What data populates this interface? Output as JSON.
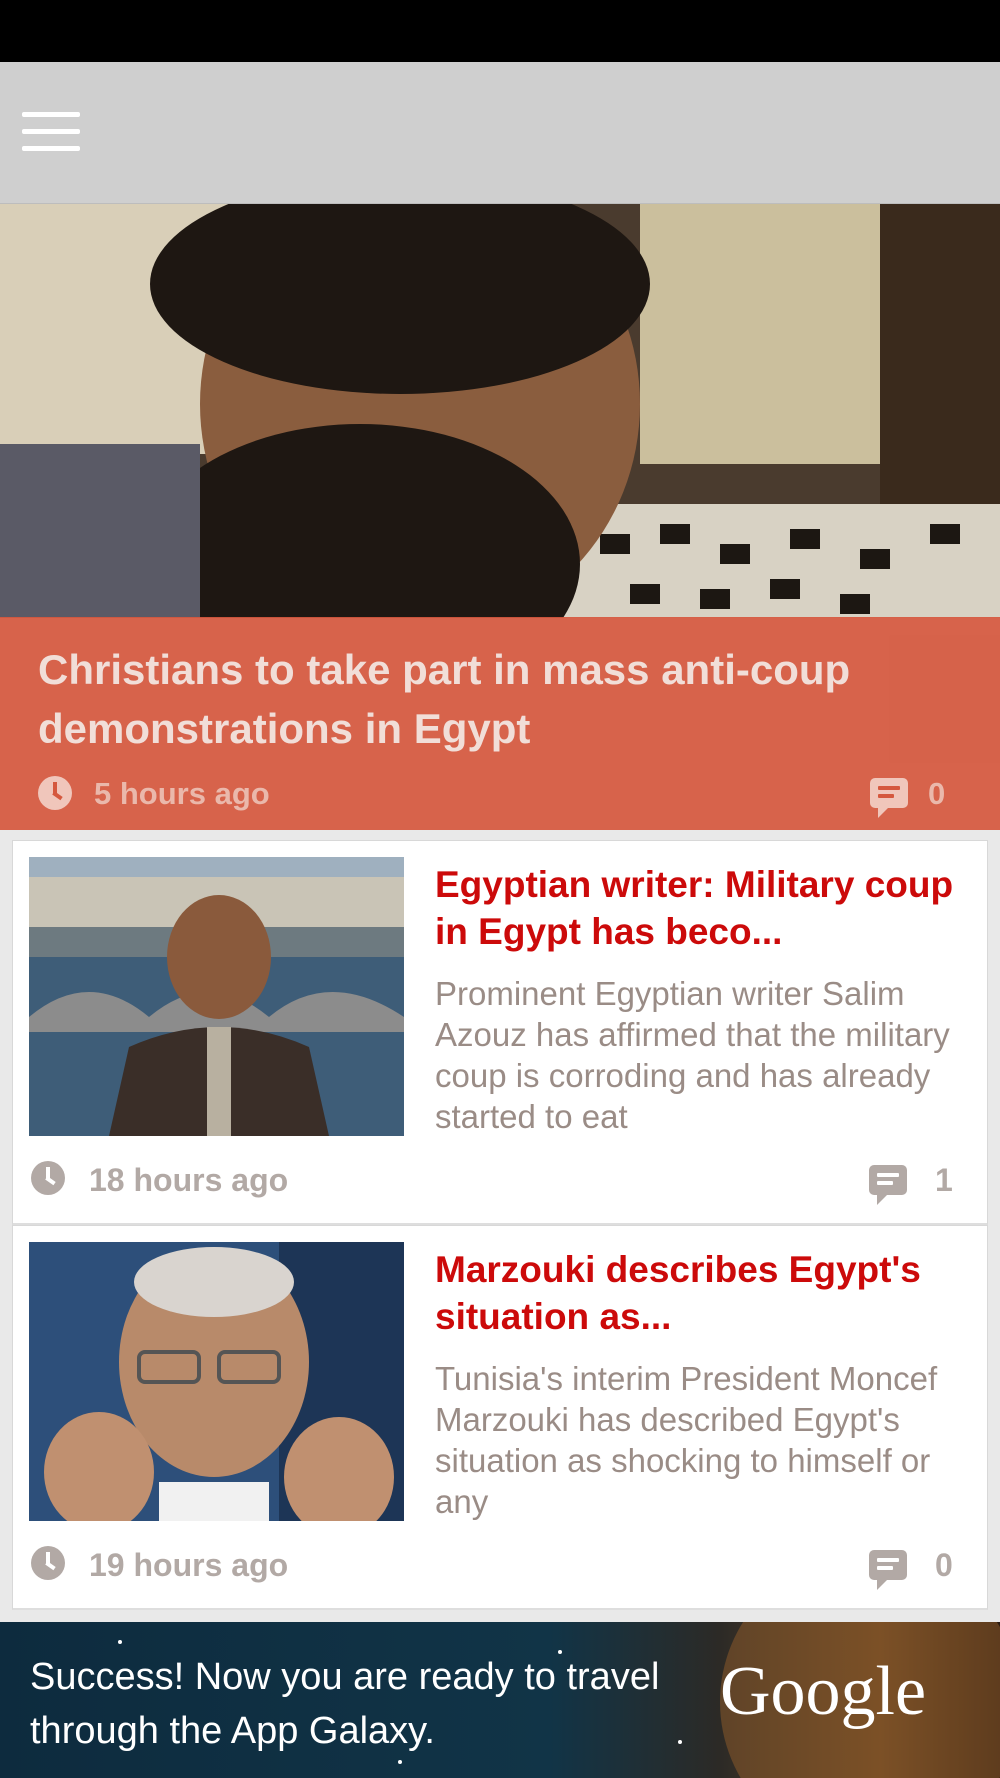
{
  "toolbar": {
    "menu_icon": "hamburger-menu-icon"
  },
  "hero": {
    "title": "Christians to take part in mass anti-coup demonstrations in Egypt",
    "time": "5 hours ago",
    "comments": "0",
    "overlay_color": "#d5583e"
  },
  "articles": [
    {
      "title": "Egyptian writer: Military coup in Egypt has beco...",
      "summary": "Prominent Egyptian writer Salim Azouz has affirmed that the military coup is corroding and has already started to eat",
      "time": "18 hours ago",
      "comments": "1"
    },
    {
      "title": "Marzouki describes Egypt's situation as...",
      "summary": "Tunisia's interim President Moncef Marzouki has described Egypt's situation as shocking to himself or any",
      "time": "19 hours ago",
      "comments": "0"
    }
  ],
  "ad": {
    "text": "Success! Now you are ready to travel through the App Galaxy.",
    "logo": "Google"
  },
  "colors": {
    "title_red": "#cc0a0a",
    "meta_gray": "#b2a9a5",
    "toolbar_gray": "#cfcfcf"
  }
}
